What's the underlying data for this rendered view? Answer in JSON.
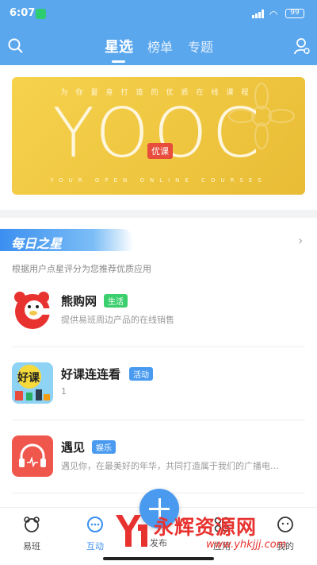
{
  "status_bar": {
    "time": "6:07",
    "battery": "99"
  },
  "header": {
    "tabs": [
      {
        "label": "星选",
        "active": true
      },
      {
        "label": "榜单",
        "active": false
      },
      {
        "label": "专题",
        "active": false
      }
    ]
  },
  "banner": {
    "tagline": "为你量身打造的优质在线课程",
    "logo": "YOOC",
    "badge": "优课",
    "subline": "YOUR   OPEN   ONLINE   COURSES"
  },
  "daily": {
    "title": "每日之星",
    "arrow": "›",
    "desc": "根据用户点星评分为您推荐优质应用"
  },
  "apps": [
    {
      "name": "熊购网",
      "tag": "生活",
      "tag_color": "#3ccf6e",
      "desc": "提供易班周边产品的在线销售"
    },
    {
      "name": "好课连连看",
      "tag": "活动",
      "tag_color": "#4a9bf0",
      "desc": "1"
    },
    {
      "name": "遇见",
      "tag": "娱乐",
      "tag_color": "#4a9bf0",
      "desc": "遇见你，在最美好的年华，共同打造属于我们的广播电…"
    }
  ],
  "bottom_nav": [
    {
      "label": "易班",
      "active": false
    },
    {
      "label": "互动",
      "active": true
    },
    {
      "label": "发布",
      "active": false
    },
    {
      "label": "应用",
      "active": false
    },
    {
      "label": "我的",
      "active": false
    }
  ],
  "watermark": {
    "text": "永辉资源网",
    "url": "www.yhkjjj.com"
  },
  "colors": {
    "primary": "#5aa7ee",
    "accent": "#3b8ff0",
    "banner": "#f3c93f"
  }
}
